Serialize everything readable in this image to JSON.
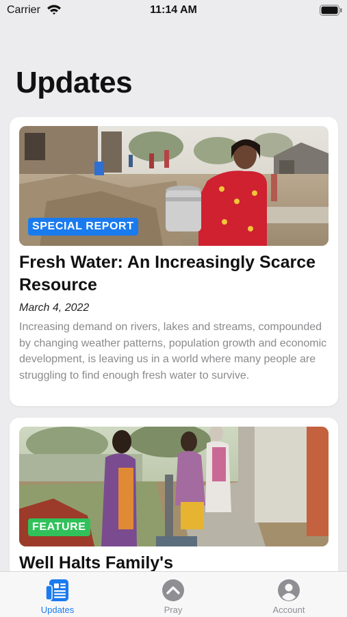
{
  "status_bar": {
    "carrier": "Carrier",
    "time": "11:14 AM"
  },
  "page": {
    "title": "Updates"
  },
  "articles": [
    {
      "badge": "SPECIAL REPORT",
      "badge_color": "#1a7bef",
      "title": "Fresh Water: An Increasingly Scarce Resource",
      "date": "March 4, 2022",
      "summary": "Increasing demand on rivers, lakes and streams, compounded by changing weather patterns, population growth and economic development, is leaving us in a world where many people are struggling to find enough fresh water to survive.",
      "image_icon": "photo-woman-carrying-water-can"
    },
    {
      "badge": "FEATURE",
      "badge_color": "#31c15a",
      "title": "Well Halts Family's",
      "image_icon": "photo-women-at-hand-pump"
    }
  ],
  "tab_bar": {
    "accent": "#1a7bef",
    "items": [
      {
        "label": "Updates",
        "icon": "newspaper-icon",
        "selected": true
      },
      {
        "label": "Pray",
        "icon": "chevron-up-circle-icon",
        "selected": false
      },
      {
        "label": "Account",
        "icon": "person-circle-icon",
        "selected": false
      }
    ]
  }
}
